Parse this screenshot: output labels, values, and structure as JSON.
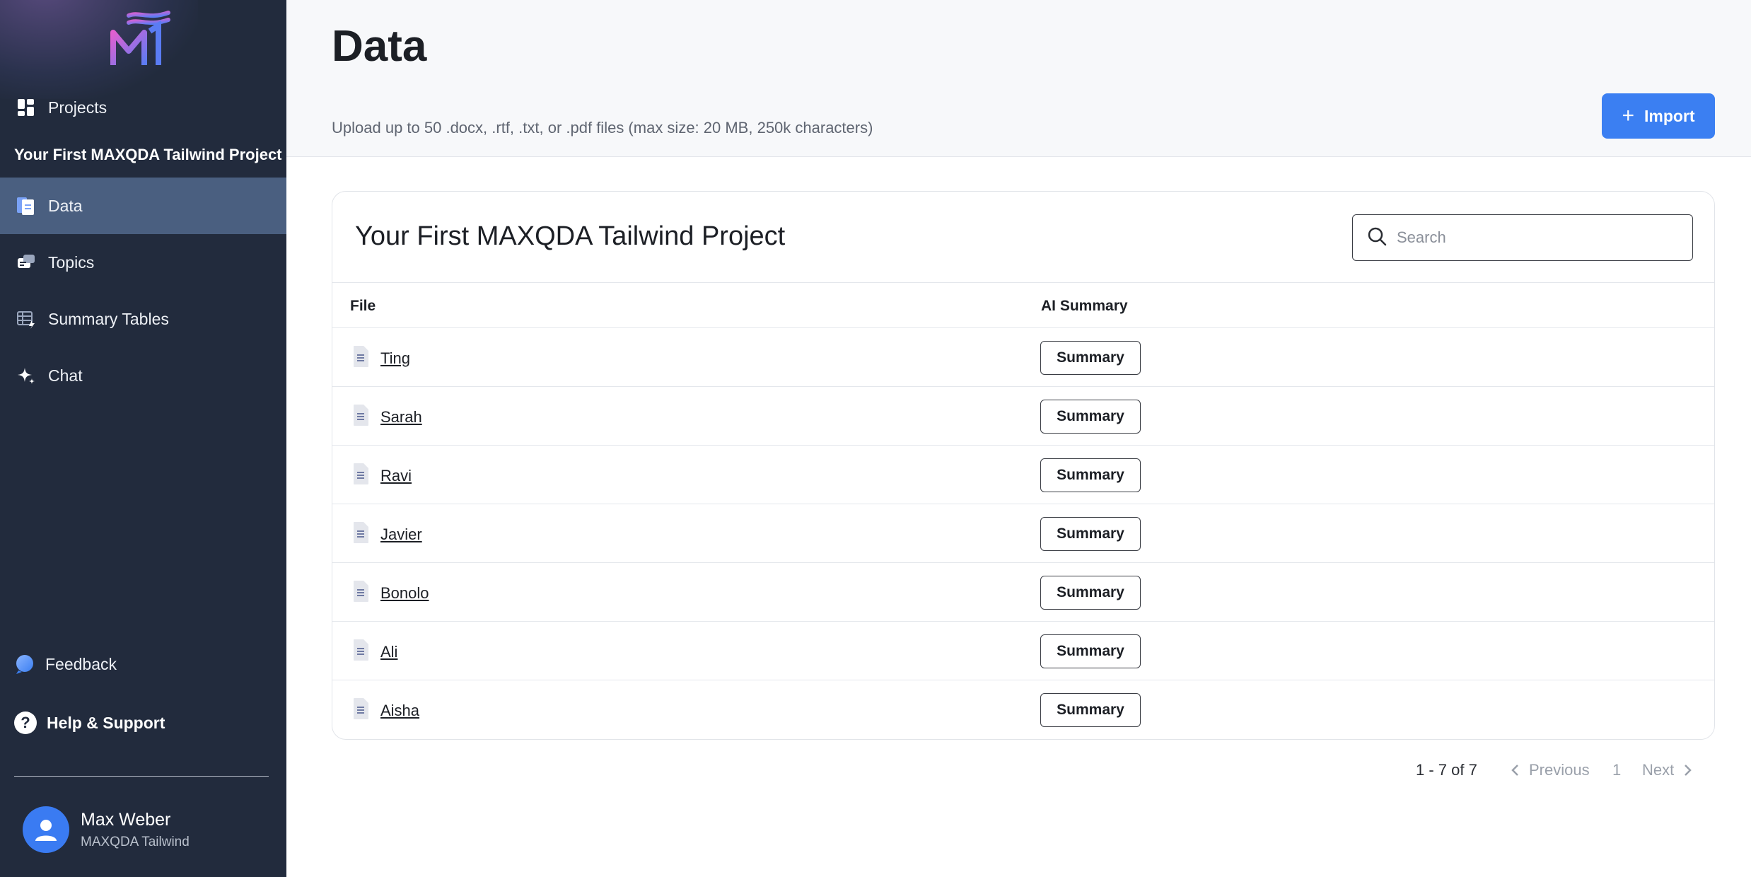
{
  "sidebar": {
    "projects_label": "Projects",
    "project_name": "Your First MAXQDA Tailwind Project",
    "items": [
      {
        "label": "Data",
        "icon": "document-icon",
        "active": true
      },
      {
        "label": "Topics",
        "icon": "topics-icon",
        "active": false
      },
      {
        "label": "Summary Tables",
        "icon": "summary-table-icon",
        "active": false
      },
      {
        "label": "Chat",
        "icon": "sparkle-icon",
        "active": false
      }
    ],
    "feedback_label": "Feedback",
    "help_label": "Help & Support",
    "user": {
      "name": "Max Weber",
      "org": "MAXQDA Tailwind"
    }
  },
  "header": {
    "title": "Data",
    "upload_note": "Upload up to 50 .docx, .rtf, .txt, or .pdf files (max size: 20 MB, 250k characters)",
    "import_label": "Import"
  },
  "card": {
    "title": "Your First MAXQDA Tailwind Project",
    "search_placeholder": "Search",
    "columns": {
      "file": "File",
      "summary": "AI Summary"
    },
    "rows": [
      {
        "file": "Ting",
        "action": "Summary"
      },
      {
        "file": "Sarah",
        "action": "Summary"
      },
      {
        "file": "Ravi",
        "action": "Summary"
      },
      {
        "file": "Javier",
        "action": "Summary"
      },
      {
        "file": "Bonolo",
        "action": "Summary"
      },
      {
        "file": "Ali",
        "action": "Summary"
      },
      {
        "file": "Aisha",
        "action": "Summary"
      }
    ]
  },
  "pagination": {
    "range": "1 - 7 of 7",
    "previous": "Previous",
    "page": "1",
    "next": "Next"
  },
  "colors": {
    "sidebar_bg": "#222b3d",
    "active_item": "#4a5f80",
    "accent": "#3b7ff2"
  }
}
